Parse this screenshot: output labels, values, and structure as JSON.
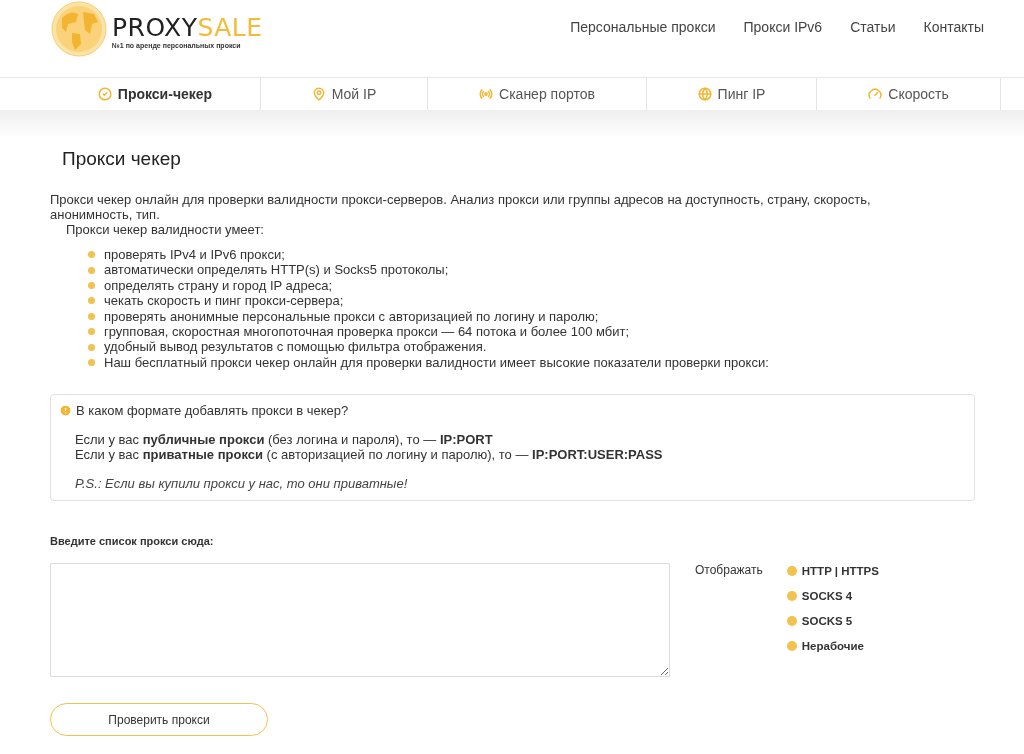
{
  "logo": {
    "brand_dark": "PROXY",
    "brand_light": "SALE",
    "tagline": "№1 по аренде персональных прокси"
  },
  "top_menu": [
    "Персональные прокси",
    "Прокси IPv6",
    "Статьи",
    "Контакты"
  ],
  "tools_nav": [
    {
      "label": "Прокси-чекер",
      "selected": true
    },
    {
      "label": "Мой IP",
      "selected": false
    },
    {
      "label": "Сканер портов",
      "selected": false
    },
    {
      "label": "Пинг IP",
      "selected": false
    },
    {
      "label": "Скорость",
      "selected": false
    }
  ],
  "page_title": "Прокси чекер",
  "intro": "Прокси чекер онлайн для проверки валидности прокси-серверов. Анализ прокси или группы адресов на доступность, страну, скорость, анонимность, тип.",
  "features_heading": "Прокси чекер валидности умеет:",
  "features": [
    "проверять IPv4 и IPv6 прокси;",
    "автоматически определять HTTP(s) и Socks5 протоколы;",
    "определять страну и город IP адреса;",
    "чекать скорость и пинг прокси-сервера;",
    "проверять анонимные персональные прокси с авторизацией по логину и паролю;",
    "групповая, скоростная многопоточная проверка прокси — 64 потока и более 100 мбит;",
    "удобный вывод результатов с помощью фильтра отображения.",
    "Наш бесплатный прокси чекер онлайн для проверки валидности имеет высокие показатели проверки прокси:"
  ],
  "info_box": {
    "question": "В каком формате добавлять прокси в чекер?",
    "lines": [
      "Если у вас **публичные прокси** (без логина и пароля), то — **IP:PORT**",
      "Если у вас **приватные прокси** (с авторизацией по логину и паролю), то — **IP:PORT:USER:PASS**"
    ],
    "note": "P.S.: Если вы купили прокси у нас, то они приватные!"
  },
  "input_label": "Введите список прокси сюда:",
  "filter": {
    "label": "Отображать",
    "options": [
      {
        "label": "HTTP | HTTPS",
        "checked": true
      },
      {
        "label": "SOCKS 4",
        "checked": true
      },
      {
        "label": "SOCKS 5",
        "checked": true
      },
      {
        "label": "Нерабочие",
        "checked": true
      }
    ]
  },
  "submit_button": "Проверить прокси"
}
